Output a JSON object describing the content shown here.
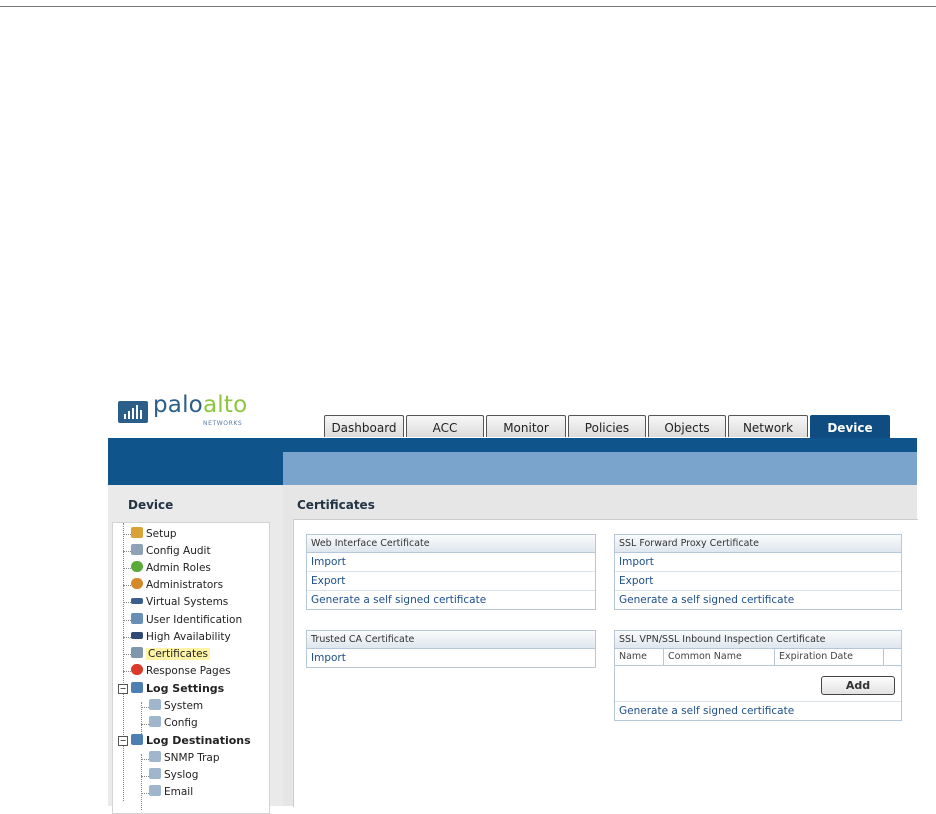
{
  "brand": {
    "part1": "palo",
    "part2": "alto",
    "sub": "NETWORKS",
    "colors": {
      "blue": "#2c5e8a",
      "green": "#8dc63f"
    }
  },
  "tabs": [
    {
      "label": "Dashboard"
    },
    {
      "label": "ACC"
    },
    {
      "label": "Monitor"
    },
    {
      "label": "Policies"
    },
    {
      "label": "Objects"
    },
    {
      "label": "Network"
    },
    {
      "label": "Device",
      "active": true
    }
  ],
  "sidebar": {
    "title": "Device",
    "items": [
      {
        "label": "Setup",
        "icon": "setup-icon"
      },
      {
        "label": "Config Audit",
        "icon": "config-audit-icon"
      },
      {
        "label": "Admin Roles",
        "icon": "admin-roles-icon"
      },
      {
        "label": "Administrators",
        "icon": "administrators-icon"
      },
      {
        "label": "Virtual Systems",
        "icon": "virtual-systems-icon"
      },
      {
        "label": "User Identification",
        "icon": "user-identification-icon"
      },
      {
        "label": "High Availability",
        "icon": "high-availability-icon"
      },
      {
        "label": "Certificates",
        "icon": "certificates-icon",
        "selected": true
      },
      {
        "label": "Response Pages",
        "icon": "response-pages-icon"
      },
      {
        "label": "Log Settings",
        "icon": "log-settings-icon"
      },
      {
        "label": "System",
        "icon": "log-icon"
      },
      {
        "label": "Config",
        "icon": "log-icon"
      },
      {
        "label": "Log Destinations",
        "icon": "log-destinations-icon"
      },
      {
        "label": "SNMP Trap",
        "icon": "log-icon"
      },
      {
        "label": "Syslog",
        "icon": "log-icon"
      },
      {
        "label": "Email",
        "icon": "log-icon"
      }
    ]
  },
  "main": {
    "title": "Certificates",
    "web_cert": {
      "title": "Web Interface Certificate",
      "import": "Import",
      "export": "Export",
      "generate": "Generate a self signed certificate"
    },
    "ssl_forward": {
      "title": "SSL Forward Proxy Certificate",
      "import": "Import",
      "export": "Export",
      "generate": "Generate a self signed certificate"
    },
    "trusted_ca": {
      "title": "Trusted CA Certificate",
      "import": "Import"
    },
    "ssl_vpn": {
      "title": "SSL VPN/SSL Inbound Inspection Certificate",
      "columns": [
        "Name",
        "Common Name",
        "Expiration Date"
      ],
      "add": "Add",
      "generate": "Generate a self signed certificate"
    }
  }
}
